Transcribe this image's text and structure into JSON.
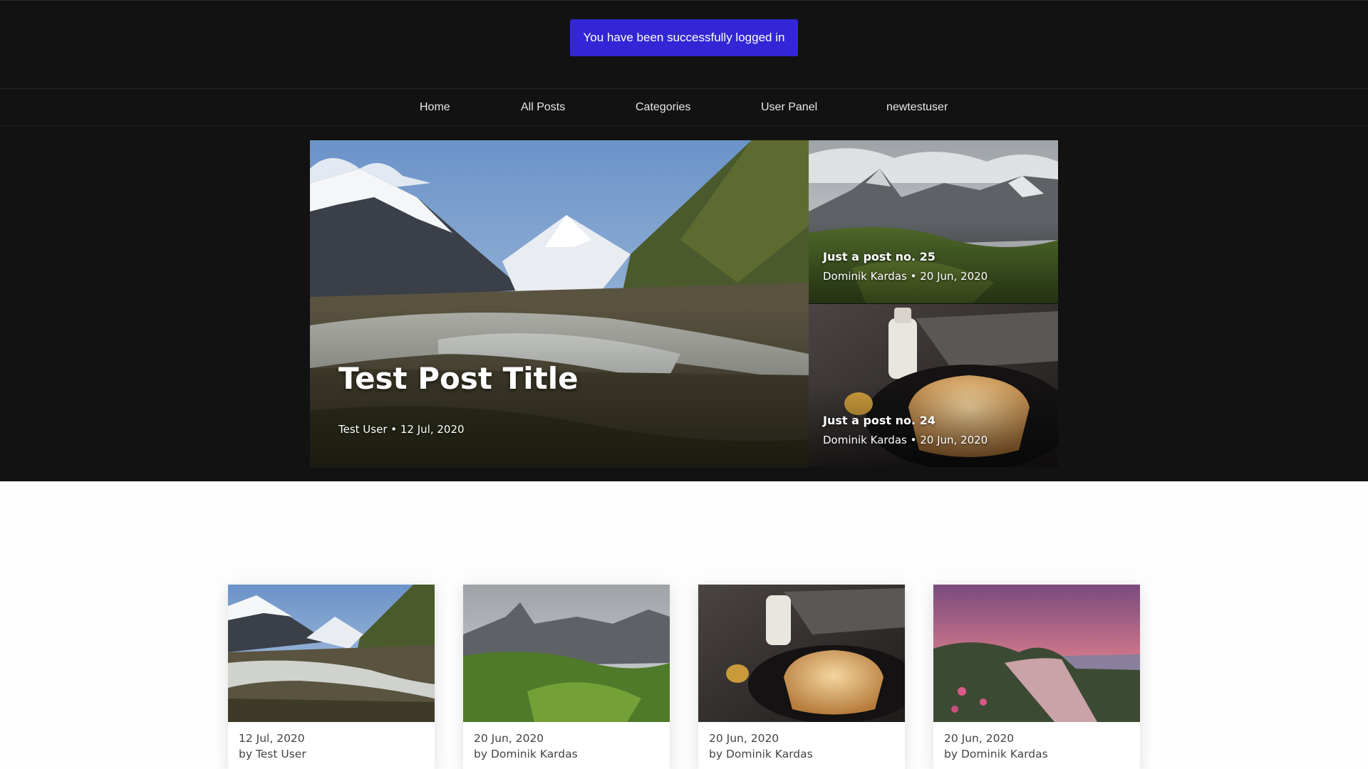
{
  "flash": {
    "message": "You have been successfully logged in"
  },
  "nav": {
    "items": [
      {
        "label": "Home"
      },
      {
        "label": "All Posts"
      },
      {
        "label": "Categories"
      },
      {
        "label": "User Panel"
      },
      {
        "label": "newtestuser"
      }
    ]
  },
  "hero": {
    "main": {
      "title": "Test Post Title",
      "meta": "Test User • 12 Jul, 2020"
    },
    "side": [
      {
        "title": "Just a post no. 25",
        "meta": "Dominik Kardas • 20 Jun, 2020"
      },
      {
        "title": "Just a post no. 24",
        "meta": "Dominik Kardas • 20 Jun, 2020"
      }
    ]
  },
  "posts": [
    {
      "date": "12 Jul, 2020",
      "author": "by Test User"
    },
    {
      "date": "20 Jun, 2020",
      "author": "by Dominik Kardas"
    },
    {
      "date": "20 Jun, 2020",
      "author": "by Dominik Kardas"
    },
    {
      "date": "20 Jun, 2020",
      "author": "by Dominik Kardas"
    }
  ],
  "colors": {
    "header_bg": "#121212",
    "flash_bg": "#3226d6",
    "page_bg": "#fdfdfd"
  }
}
